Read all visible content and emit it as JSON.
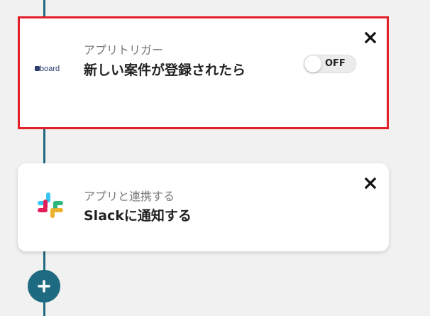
{
  "trigger": {
    "app_logo": "board",
    "subtitle": "アプリトリガー",
    "title": "新しい案件が登録されたら",
    "toggle_label": "OFF",
    "toggle_on": false,
    "close_icon": "close-icon"
  },
  "action": {
    "app_logo": "slack-icon",
    "subtitle": "アプリと連携する",
    "title": "Slackに通知する",
    "close_icon": "close-icon"
  },
  "add_button": {
    "icon": "plus-icon"
  },
  "colors": {
    "connector": "#1e6a80",
    "highlight": "#e3202a",
    "background": "#f1f1f1",
    "card": "#ffffff"
  }
}
